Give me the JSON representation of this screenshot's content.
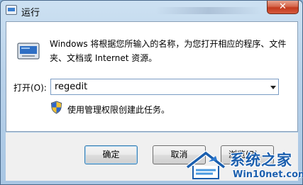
{
  "window": {
    "title": "运行",
    "close_glyph": "✕"
  },
  "main": {
    "description": "Windows 将根据您所输入的名称，为您打开相应的程序、文件夹、文档或 Internet 资源。",
    "open_label": "打开(O):",
    "open_value": "regedit",
    "uac_text": "使用管理权限创建此任务。"
  },
  "buttons": {
    "ok": "确定",
    "cancel": "取消",
    "browse": "浏览(B)..."
  },
  "watermark": {
    "title": "系统之家",
    "url": "Win10net.com"
  },
  "icons": {
    "window_icon": "run-app-icon",
    "program_icon": "run-program-icon",
    "shield": "uac-shield-icon",
    "logo": "house-logo-icon"
  },
  "colors": {
    "close_red": "#c2391d",
    "watermark_blue": "#1b5fae"
  }
}
